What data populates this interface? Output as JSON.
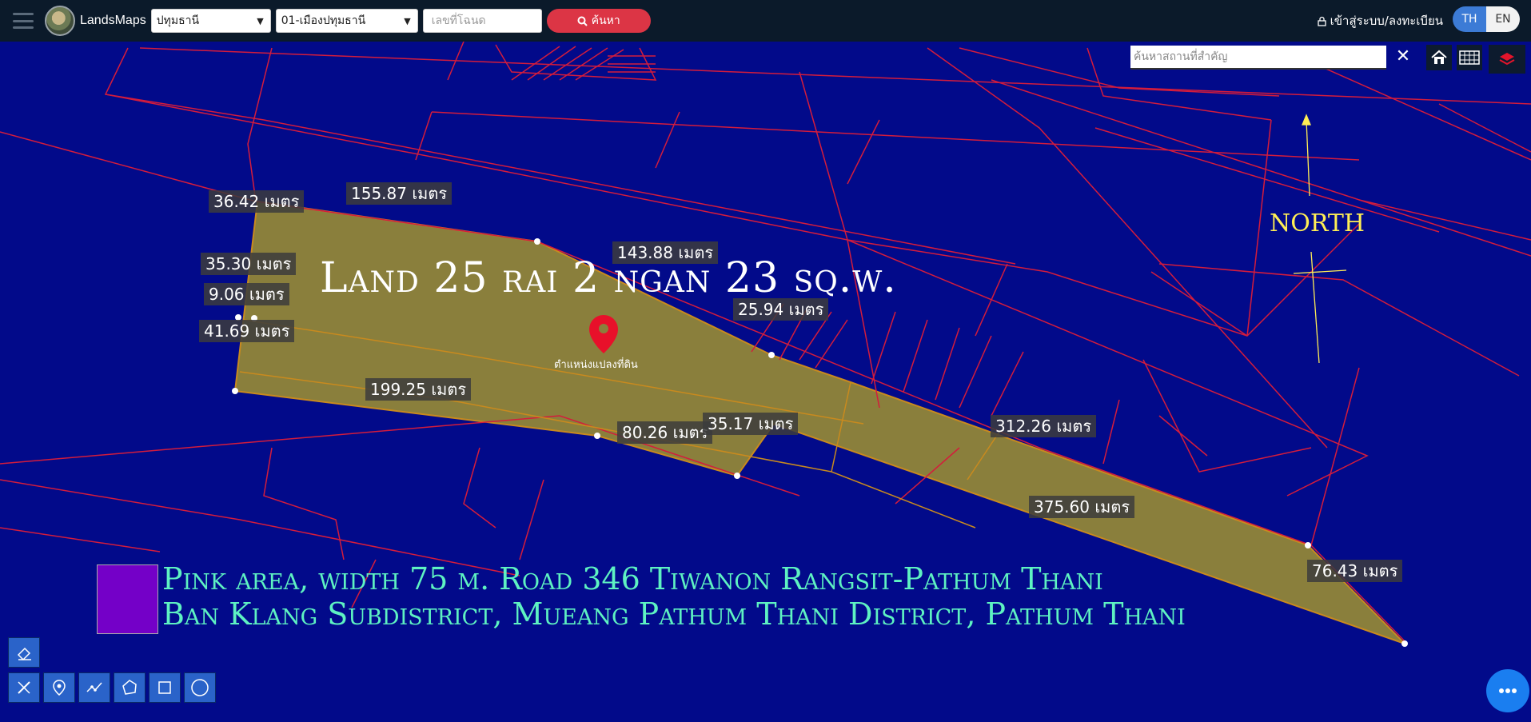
{
  "topbar": {
    "brand": "LandsMaps",
    "province_select": "ปทุมธานี",
    "district_select": "01-เมืองปทุมธานี",
    "deed_placeholder": "เลขที่โฉนด",
    "search_button": "ค้นหา",
    "login_label": "เข้าสู่ระบบ/ลงทะเบียน",
    "lang_th": "TH",
    "lang_en": "EN"
  },
  "map_controls": {
    "place_search_placeholder": "ค้นหาสถานที่สำคัญ",
    "close_symbol": "✕"
  },
  "map": {
    "title": "Land 25 rai 2 ngan 23 sq.w.",
    "north_label": "NORTH",
    "poi_label": "ตำแหน่งแปลงที่ดิน",
    "measurements": [
      "36.42 เมตร",
      "155.87 เมตร",
      "143.88 เมตร",
      "35.30 เมตร",
      "9.06 เมตร",
      "41.69 เมตร",
      "25.94 เมตร",
      "199.25 เมตร",
      "80.26 เมตร",
      "35.17 เมตร",
      "312.26 เมตร",
      "375.60 เมตร",
      "76.43 เมตร"
    ],
    "legend_line1": "Pink area, width 75 m. Road 346 Tiwanon Rangsit-Pathum Thani",
    "legend_line2": "Ban Klang Subdistrict, Mueang Pathum Thani District, Pathum Thani",
    "colors": {
      "background": "#020a8a",
      "parcel_lines": "#d41c3c",
      "parcel_fill": "#8a7f3c",
      "legend_text": "#5ef2c2",
      "legend_swatch": "#7400c8",
      "north": "#ffee55"
    }
  },
  "tools": [
    "eraser-icon",
    "ruler-icon",
    "pin-icon",
    "polyline-icon",
    "polygon-icon",
    "rectangle-icon",
    "circle-icon"
  ]
}
